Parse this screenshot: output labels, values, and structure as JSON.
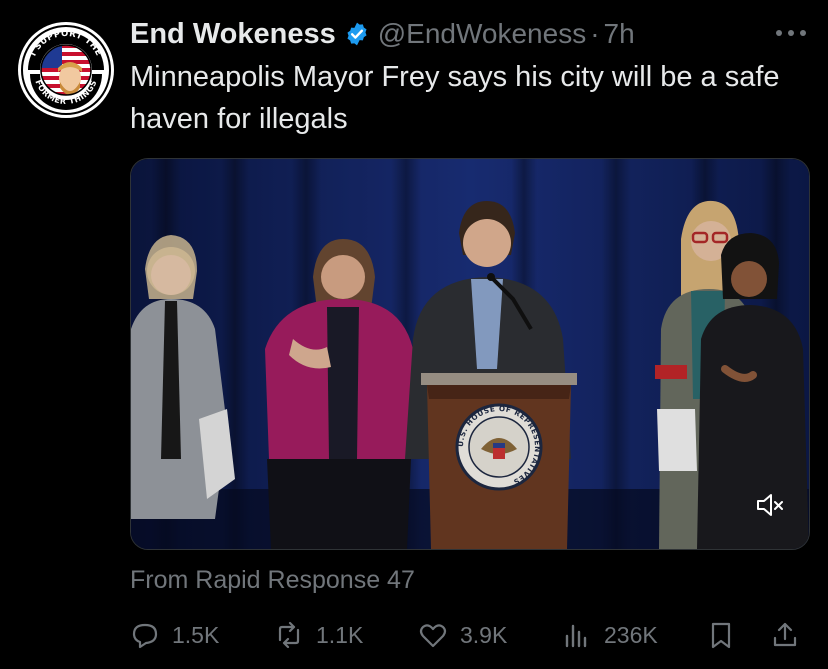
{
  "author": {
    "name": "End Wokeness",
    "handle": "@EndWokeness",
    "separator": "·",
    "time": "7h",
    "avatar_text_top": "I SUPPORT THE",
    "avatar_text_bottom": "FORMER THINGS"
  },
  "tweet": {
    "text": "Minneapolis Mayor Frey says his city will be a safe haven for illegals"
  },
  "media": {
    "podium_seal_text": "U.S. HOUSE OF REPRESENTATIVES",
    "sound": "muted"
  },
  "source_label": "From Rapid Response 47",
  "actions": {
    "replies": "1.5K",
    "reposts": "1.1K",
    "likes": "3.9K",
    "views": "236K"
  },
  "colors": {
    "background": "#000000",
    "text": "#e7e9ea",
    "muted": "#71767b",
    "verified": "#1d9bf0"
  },
  "icons": [
    "verified-badge-icon",
    "more-icon",
    "mute-icon",
    "reply-icon",
    "repost-icon",
    "like-icon",
    "views-icon",
    "bookmark-icon",
    "share-icon"
  ]
}
